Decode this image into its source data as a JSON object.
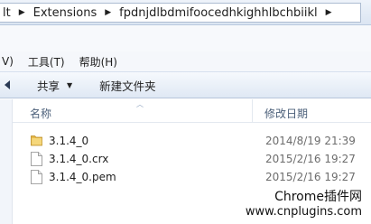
{
  "address_bar": {
    "crumbs": [
      "lt",
      "Extensions",
      "fpdnjdlbdmifoocedhkighhlbchbiikl"
    ]
  },
  "menu": {
    "items": [
      "V)",
      "工具(T)",
      "帮助(H)"
    ]
  },
  "command_bar": {
    "share_label": "共享",
    "new_folder_label": "新建文件夹"
  },
  "file_list": {
    "columns": {
      "name": "名称",
      "modified": "修改日期"
    },
    "rows": [
      {
        "name": "3.1.4_0",
        "modified": "2014/8/19 21:39",
        "icon": "folder-icon"
      },
      {
        "name": "3.1.4_0.crx",
        "modified": "2015/2/16 19:27",
        "icon": "file-icon"
      },
      {
        "name": "3.1.4_0.pem",
        "modified": "2015/2/16 19:27",
        "icon": "file-icon"
      }
    ]
  },
  "watermark": {
    "line1": "Chrome插件网",
    "line2": "www.cnplugins.com"
  }
}
